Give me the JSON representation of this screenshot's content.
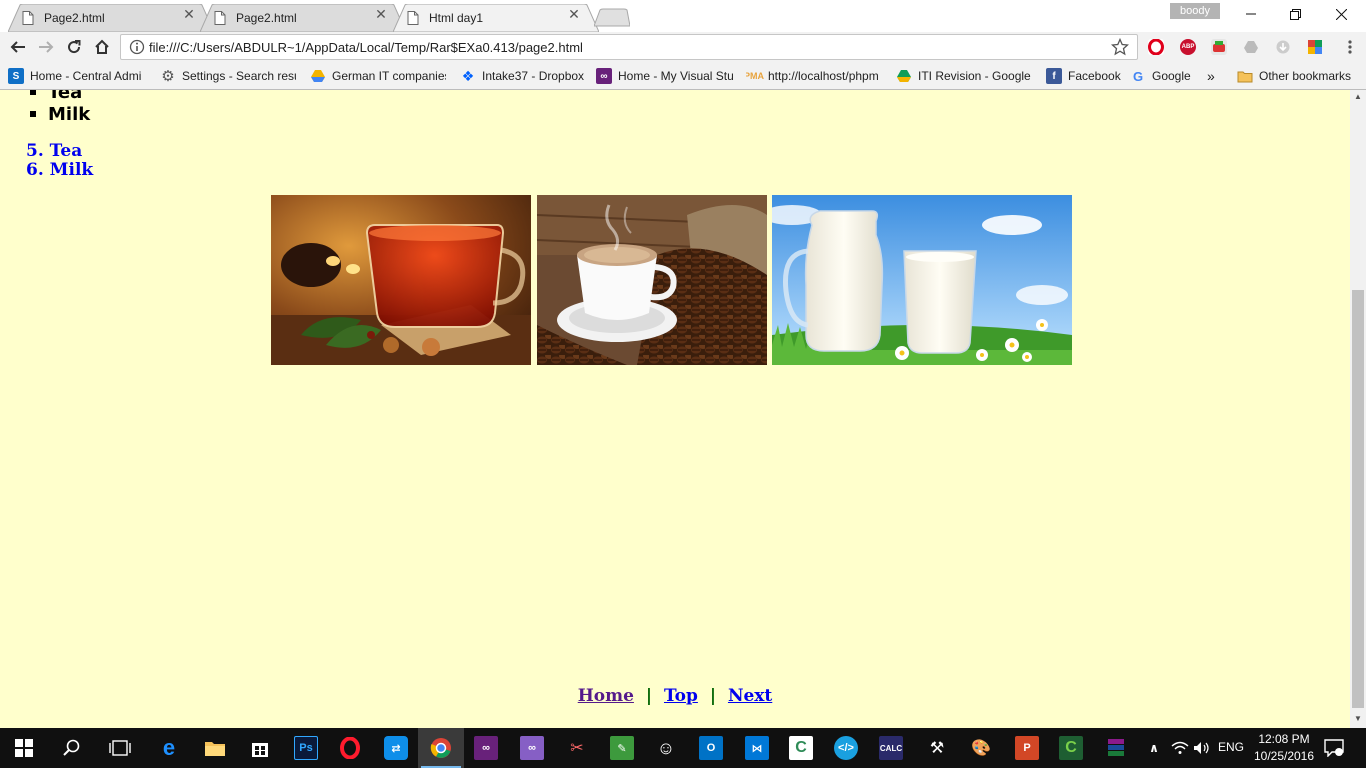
{
  "window": {
    "tabs": [
      {
        "title": "Page2.html",
        "active": false
      },
      {
        "title": "Page2.html",
        "active": false
      },
      {
        "title": "Html day1",
        "active": true
      }
    ],
    "profile_name": "boody"
  },
  "toolbar": {
    "url": "file:///C:/Users/ABDULR~1/AppData/Local/Temp/Rar$EXa0.413/page2.html",
    "extensions": [
      "opera-icon",
      "adblock-icon",
      "youtube-downloader-icon",
      "google-drive-icon",
      "download-icon",
      "chrome-extension-icon"
    ]
  },
  "bookmarks": {
    "items": [
      {
        "label": "Home - Central Admi",
        "icon": "sharepoint-icon",
        "color": "#0f6fc6"
      },
      {
        "label": "Settings - Search resu",
        "icon": "gear-icon",
        "color": "#555555"
      },
      {
        "label": "German IT companies",
        "icon": "google-drive-icon",
        "color": "#f4b400"
      },
      {
        "label": "Intake37 - Dropbox",
        "icon": "dropbox-icon",
        "color": "#0061fe"
      },
      {
        "label": "Home - My Visual Stu",
        "icon": "visual-studio-icon",
        "color": "#68217a"
      },
      {
        "label": "http://localhost/phpm",
        "icon": "phpmyadmin-icon",
        "color": "#e8a33d"
      },
      {
        "label": "ITI Revision - Google",
        "icon": "google-drive-icon",
        "color": "#0f9d58"
      },
      {
        "label": "Facebook",
        "icon": "facebook-icon",
        "color": "#3b5998"
      },
      {
        "label": "Google",
        "icon": "google-icon",
        "color": "#4285f4"
      }
    ],
    "overflow": "»",
    "other_bookmarks": "Other bookmarks"
  },
  "page": {
    "unordered_list": [
      "Tea",
      "Milk"
    ],
    "ordered_list": [
      {
        "number": "5.",
        "label": "Tea"
      },
      {
        "number": "6.",
        "label": "Milk"
      }
    ],
    "images": [
      {
        "name": "tea-image"
      },
      {
        "name": "coffee-image"
      },
      {
        "name": "milk-image"
      }
    ],
    "footer_links": {
      "home": "Home",
      "top": "Top",
      "next": "Next",
      "separator": "|"
    }
  },
  "taskbar": {
    "apps": [
      "start-icon",
      "search-icon",
      "task-view-icon",
      "edge-icon",
      "file-explorer-icon",
      "store-icon",
      "photoshop-icon",
      "opera-icon",
      "teamviewer-icon",
      "chrome-icon",
      "visual-studio-icon",
      "visual-studio-2-icon",
      "snipping-icon",
      "notepad-icon",
      "emoji-icon",
      "outlook-icon",
      "vscode-icon",
      "camtasia-icon",
      "code-icon",
      "calculator-icon",
      "tools-icon",
      "paint-icon",
      "powerpoint-icon",
      "camtasia-recorder-icon",
      "winrar-icon"
    ],
    "lang": "ENG",
    "time": "12:08 PM",
    "date": "10/25/2016"
  }
}
